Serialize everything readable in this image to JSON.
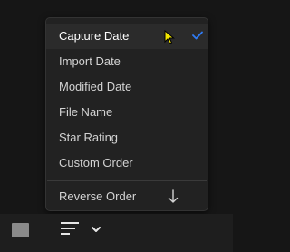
{
  "sort_menu": {
    "items": [
      {
        "label": "Capture Date"
      },
      {
        "label": "Import Date"
      },
      {
        "label": "Modified Date"
      },
      {
        "label": "File Name"
      },
      {
        "label": "Star Rating"
      },
      {
        "label": "Custom Order"
      }
    ],
    "selected_item": "Capture Date",
    "reverse_label": "Reverse Order"
  },
  "icons": {
    "checkmark": "check-icon",
    "reverse": "arrow-down-icon",
    "sort": "sort-lines-icon",
    "dropdown": "chevron-down-icon",
    "view": "square-view-icon",
    "cursor": "mouse-pointer-icon"
  },
  "colors": {
    "background": "#161616",
    "menu": "#222222",
    "accent": "#2f7bf5",
    "text": "#d3d3d3"
  }
}
